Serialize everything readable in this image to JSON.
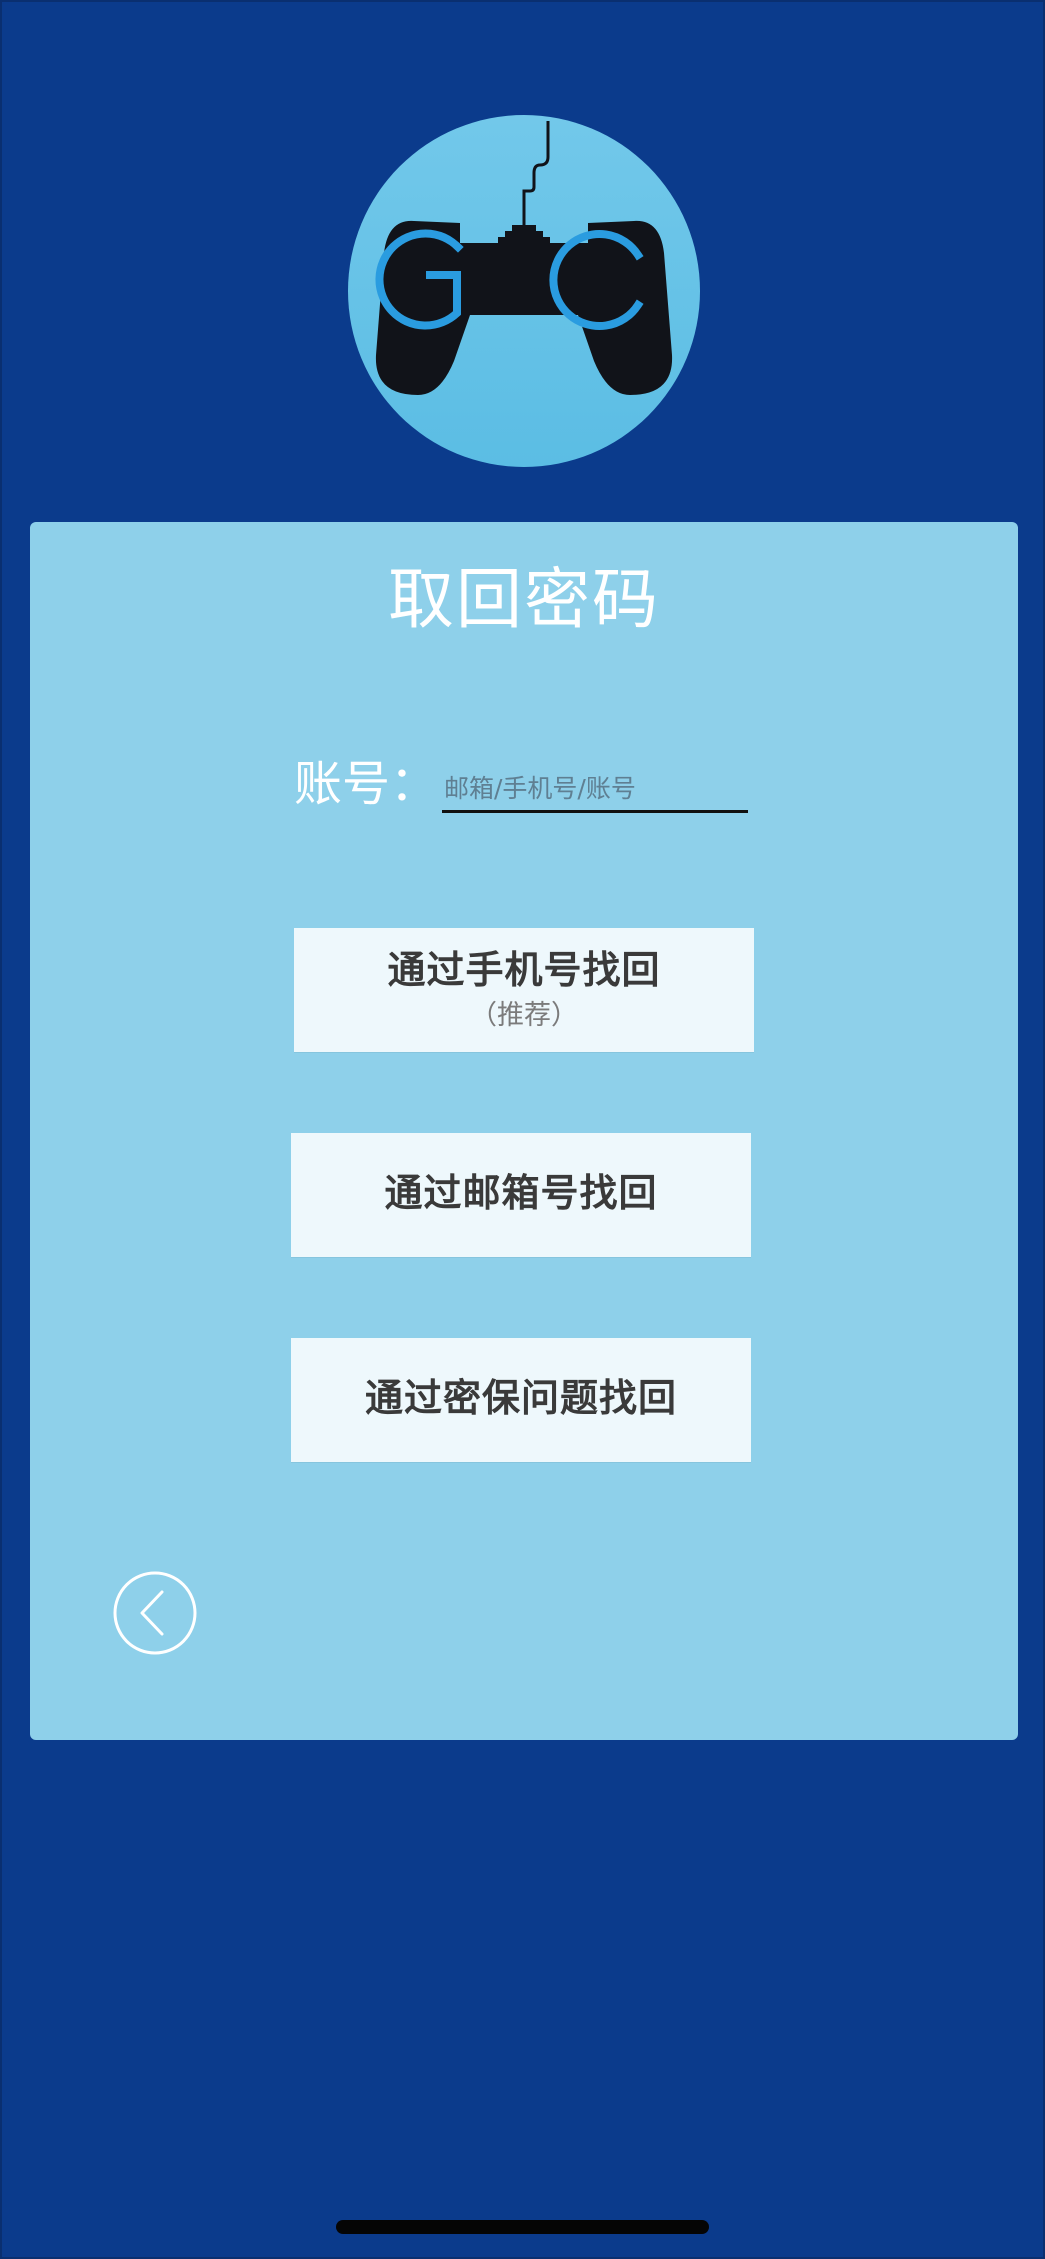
{
  "logo": {
    "text": "GC",
    "icon": "gamepad-icon",
    "colors": {
      "circle": "#66c3e6",
      "pad": "#111319",
      "letters": "#2a9ce0"
    }
  },
  "card": {
    "title": "取回密码",
    "account": {
      "label": "账号：",
      "placeholder": "邮箱/手机号/账号",
      "value": ""
    },
    "buttons": {
      "phone": {
        "label": "通过手机号找回",
        "sub": "（推荐）"
      },
      "email": {
        "label": "通过邮箱号找回"
      },
      "security_question": {
        "label": "通过密保问题找回"
      }
    },
    "back": {
      "icon": "chevron-left-icon"
    }
  },
  "colors": {
    "background": "#0b3b8c",
    "card": "#8ed0ea",
    "button": "#eef8fc",
    "title_text": "#ffffff",
    "button_text": "#3a3a3a"
  }
}
